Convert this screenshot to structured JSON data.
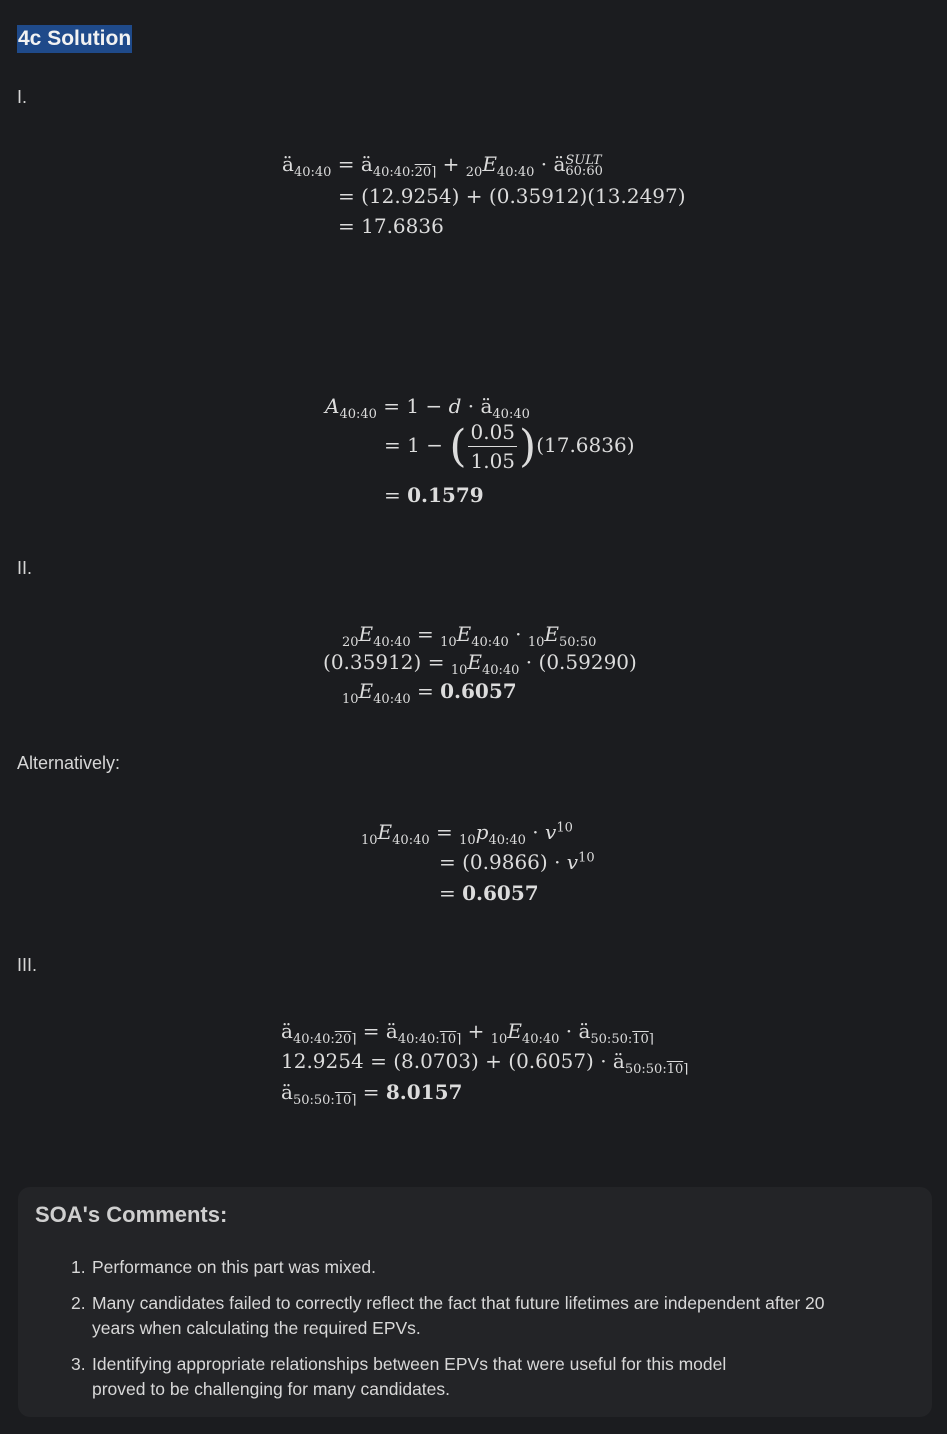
{
  "title": "4c Solution",
  "sections": {
    "part1": "I.",
    "part2": "II.",
    "alternatively": "Alternatively:",
    "part3": "III."
  },
  "equations": {
    "p1_result": "17.6836",
    "p1_a": "12.9254",
    "p1_b": "0.35912",
    "p1_c": "13.2497",
    "p1_sult": "SULT",
    "a_frac_num": "0.05",
    "a_frac_den": "1.05",
    "a_val": "17.6836",
    "a_result": "0.1579",
    "p2_a": "0.35912",
    "p2_b": "0.59290",
    "p2_result": "0.6057",
    "alt_p": "0.9866",
    "alt_result": "0.6057",
    "p3_lhs": "12.9254",
    "p3_a": "8.0703",
    "p3_b": "0.6057",
    "p3_result": "8.0157"
  },
  "comments": {
    "heading": "SOA's Comments:",
    "items": [
      {
        "num": "1.",
        "text": "Performance on this part was mixed."
      },
      {
        "num": "2.",
        "line1": "Many candidates failed to correctly reflect the fact that future lifetimes are independent after 20",
        "line2": "years when calculating the required EPVs."
      },
      {
        "num": "3.",
        "line1": "Identifying appropriate relationships between EPVs that were useful for this model",
        "line2": "proved to be challenging for many candidates."
      }
    ]
  }
}
